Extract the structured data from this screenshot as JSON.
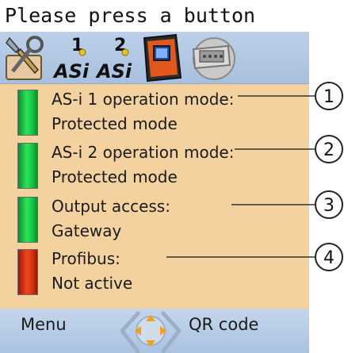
{
  "header": {
    "title": "Please press a button"
  },
  "toolbar": {
    "icons": [
      "wrench-screwdriver-icon",
      "asi-1-icon",
      "asi-2-icon",
      "gateway-device-icon",
      "profibus-connector-icon"
    ],
    "asi1_number": "1",
    "asi2_number": "2",
    "asi_text": "ASi"
  },
  "status": [
    {
      "line1": "AS-i 1 operation mode:",
      "line2": "Protected mode",
      "color": "#1fd24a"
    },
    {
      "line1": "AS-i 2 operation mode:",
      "line2": "Protected mode",
      "color": "#1fd24a"
    },
    {
      "line1": "Output access:",
      "line2": "Gateway",
      "color": "#1fd24a"
    },
    {
      "line1": "Profibus:",
      "line2": "Not active",
      "color": "#e03c16"
    }
  ],
  "callouts": [
    "1",
    "2",
    "3",
    "4"
  ],
  "softkeys": {
    "left": "Menu",
    "right": "QR code"
  }
}
